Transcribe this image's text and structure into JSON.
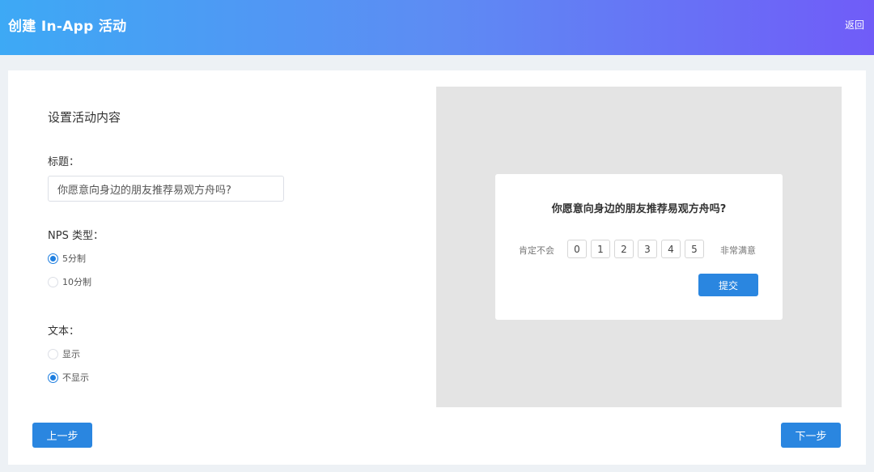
{
  "header": {
    "title": "创建 In-App 活动",
    "back_label": "返回"
  },
  "form": {
    "section_title": "设置活动内容",
    "title_label": "标题：",
    "title_value": "你愿意向身边的朋友推荐易观方舟吗?",
    "nps_label": "NPS 类型：",
    "nps_options": [
      {
        "label": "5分制",
        "checked": true
      },
      {
        "label": "10分制",
        "checked": false
      }
    ],
    "text_label": "文本：",
    "text_options": [
      {
        "label": "显示",
        "checked": false
      },
      {
        "label": "不显示",
        "checked": true
      }
    ]
  },
  "preview": {
    "question": "你愿意向身边的朋友推荐易观方舟吗?",
    "low_label": "肯定不会",
    "high_label": "非常满意",
    "scores": [
      "0",
      "1",
      "2",
      "3",
      "4",
      "5"
    ],
    "submit_label": "提交"
  },
  "footer": {
    "prev_label": "上一步",
    "next_label": "下一步"
  },
  "colors": {
    "accent": "#2a86e0",
    "header_gradient_start": "#3da9f5",
    "header_gradient_end": "#705cf8"
  }
}
